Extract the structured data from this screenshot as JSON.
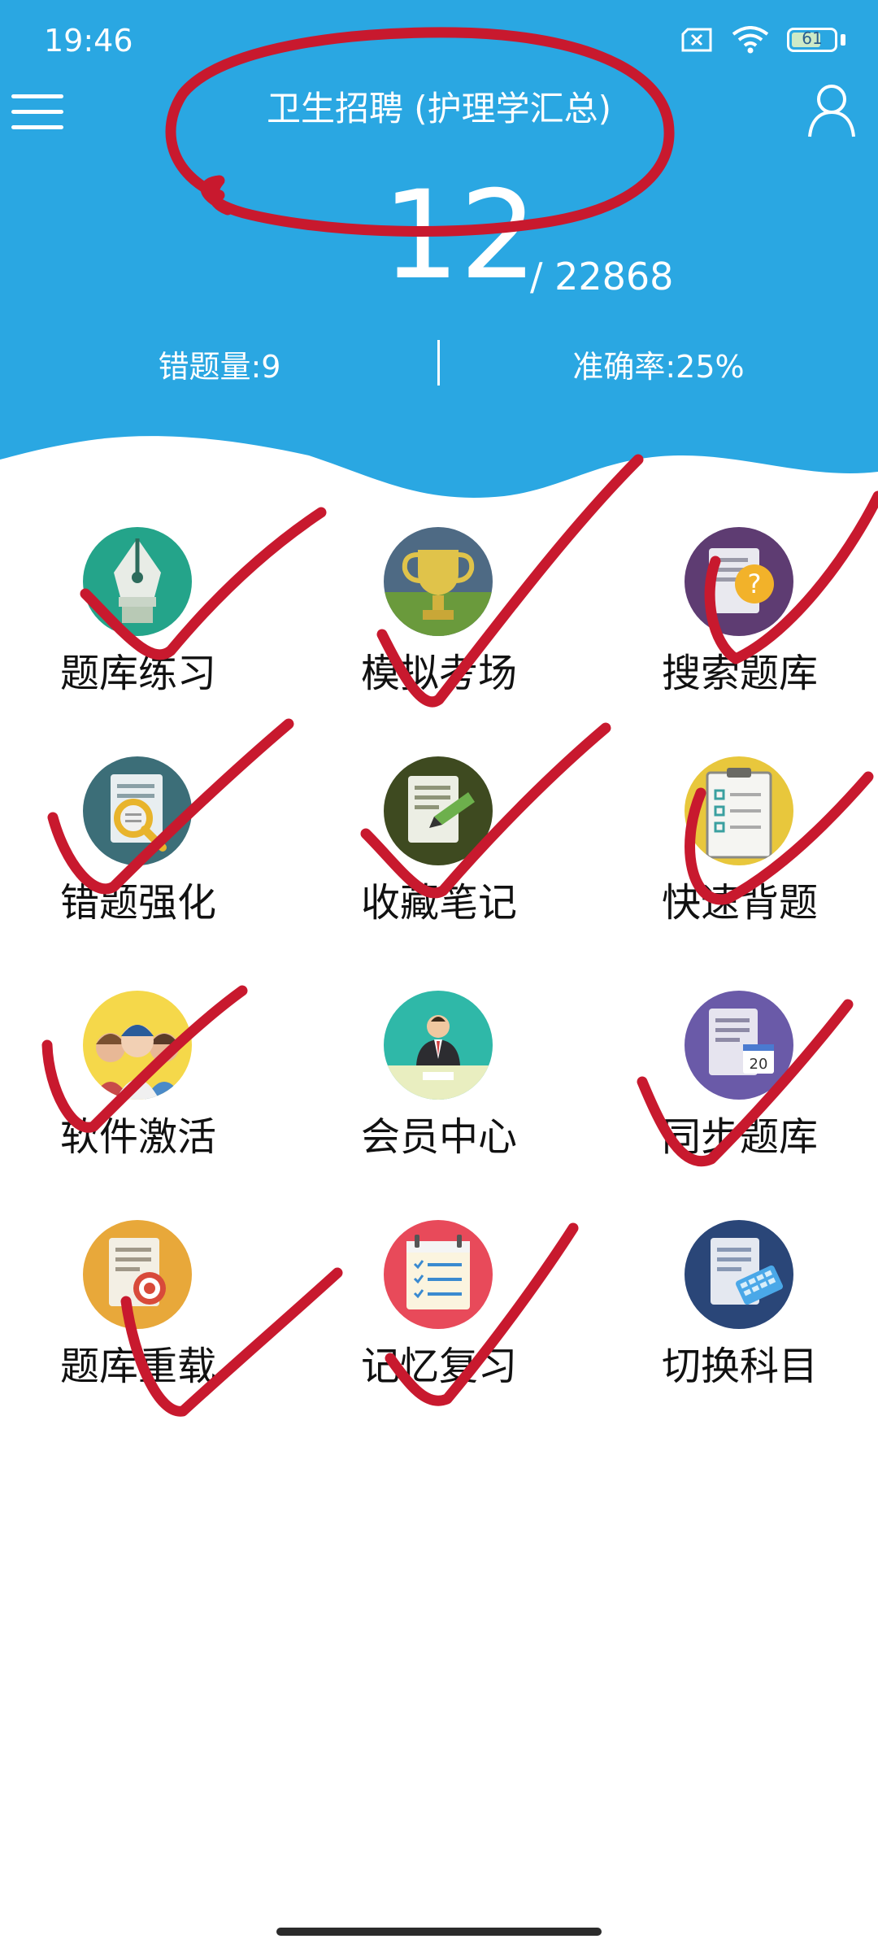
{
  "status_bar": {
    "time": "19:46",
    "battery_level": "61"
  },
  "header": {
    "title": "卫生招聘 (护理学汇总)",
    "current_count": "12",
    "total_count": "/ 22868",
    "wrong_count_label": "错题量:9",
    "accuracy_label": "准确率:25%"
  },
  "menu": [
    {
      "label": "题库练习",
      "icon": "pen-icon"
    },
    {
      "label": "模拟考场",
      "icon": "trophy-icon"
    },
    {
      "label": "搜索题库",
      "icon": "question-doc-icon"
    },
    {
      "label": "错题强化",
      "icon": "magnifier-doc-icon"
    },
    {
      "label": "收藏笔记",
      "icon": "note-pen-icon"
    },
    {
      "label": "快速背题",
      "icon": "clipboard-icon"
    },
    {
      "label": "软件激活",
      "icon": "people-group-icon"
    },
    {
      "label": "会员中心",
      "icon": "member-icon"
    },
    {
      "label": "同步题库",
      "icon": "calendar-doc-icon"
    },
    {
      "label": "题库重载",
      "icon": "target-doc-icon"
    },
    {
      "label": "记忆复习",
      "icon": "checklist-icon"
    },
    {
      "label": "切换科目",
      "icon": "keyboard-doc-icon"
    }
  ],
  "colors": {
    "header_blue": "#2aa7e2",
    "annotation_red": "#c8192e"
  }
}
